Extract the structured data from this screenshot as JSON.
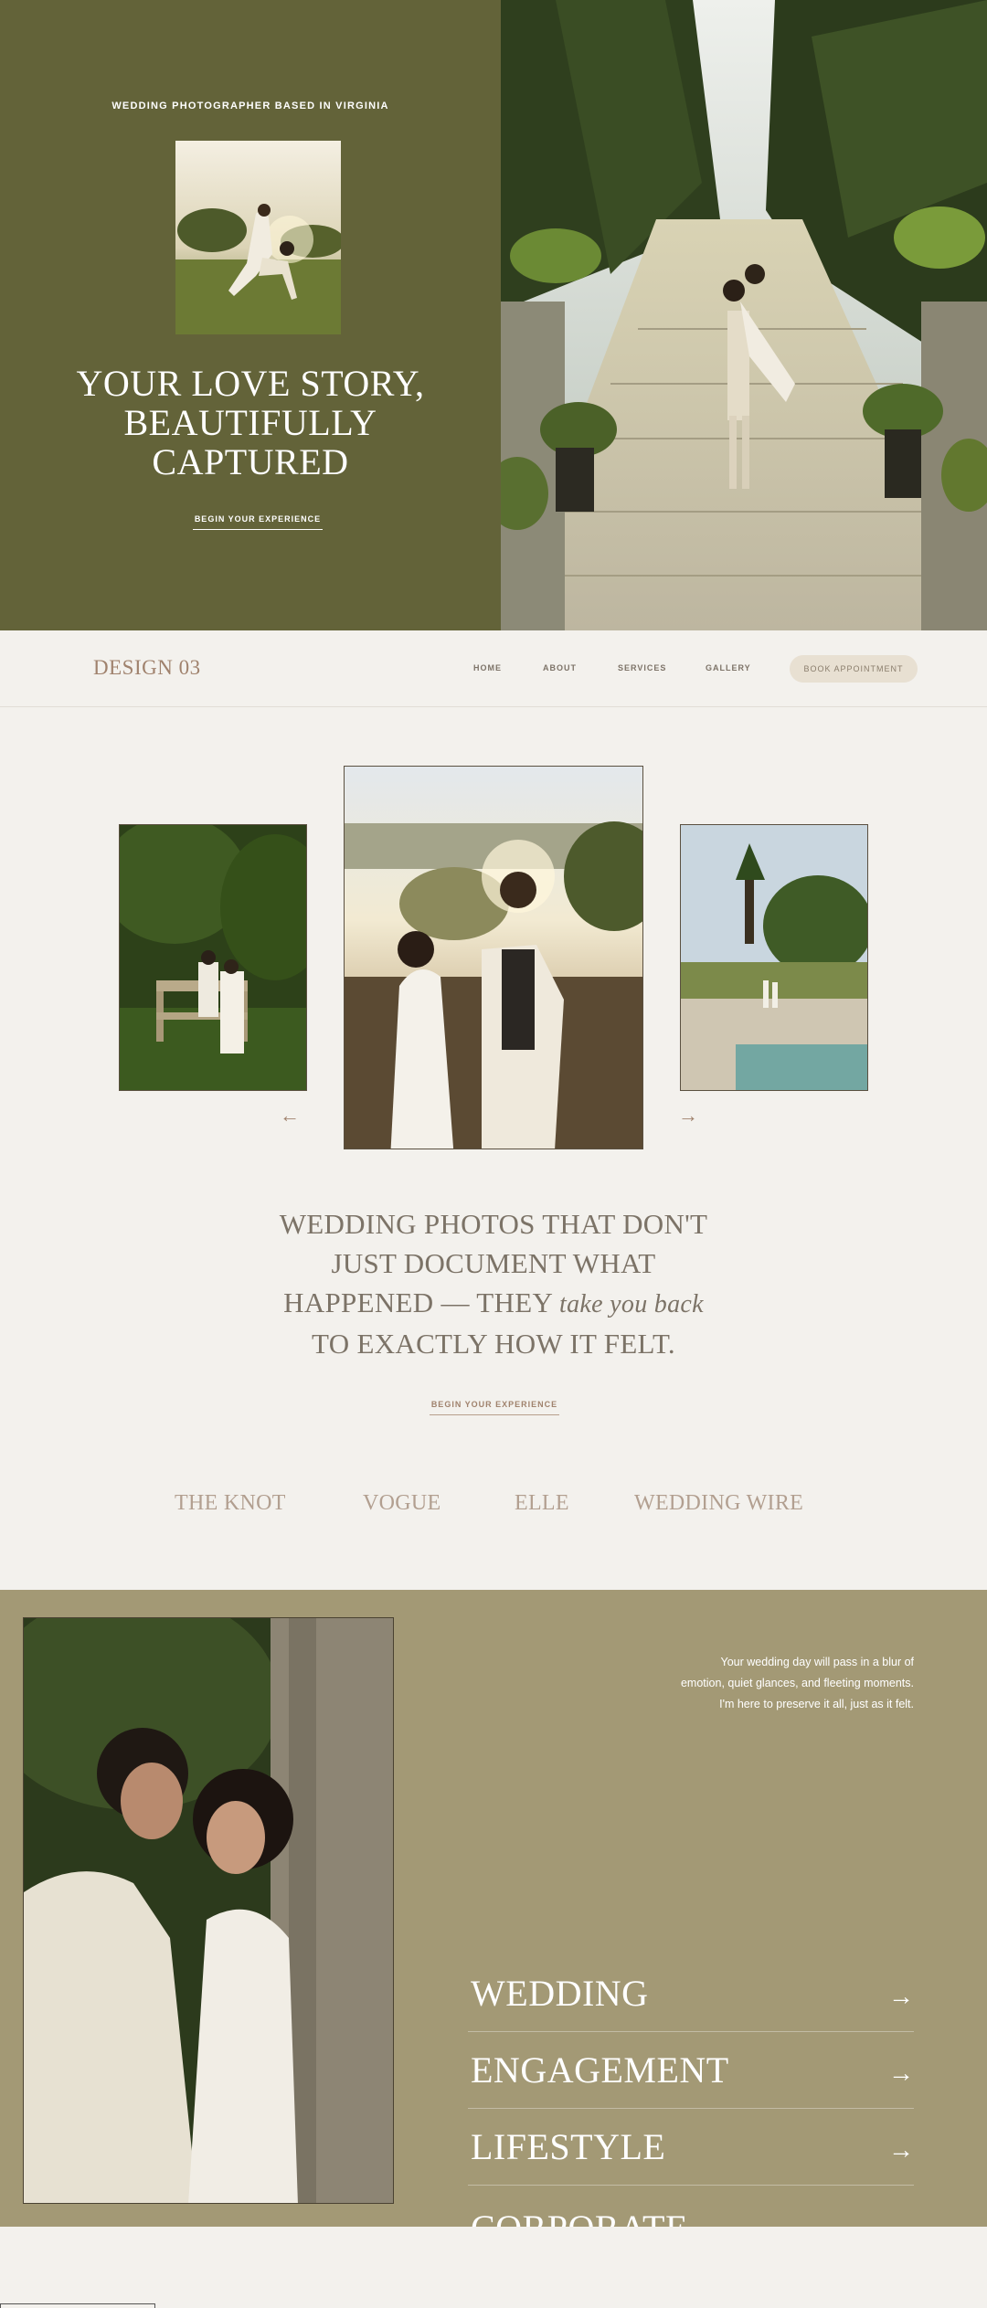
{
  "hero": {
    "eyebrow": "WEDDING PHOTOGRAPHER BASED IN VIRGINIA",
    "title_lines": [
      "YOUR LOVE STORY,",
      "BEAUTIFULLY",
      "CAPTURED"
    ],
    "cta": "BEGIN YOUR EXPERIENCE"
  },
  "nav": {
    "logo": "DESIGN 03",
    "links": [
      "HOME",
      "ABOUT",
      "SERVICES",
      "GALLERY"
    ],
    "book": "BOOK APPOINTMENT"
  },
  "gallery": {
    "prev_icon": "arrow-left-icon",
    "next_icon": "arrow-right-icon",
    "prev_glyph": "←",
    "next_glyph": "→"
  },
  "quote": {
    "lines": [
      "WEDDING PHOTOS THAT DON'T",
      "JUST DOCUMENT WHAT"
    ],
    "line3_prefix": "HAPPENED — THEY ",
    "line3_italic": "take you back",
    "line4": "TO EXACTLY HOW IT FELT.",
    "cta": "BEGIN YOUR EXPERIENCE"
  },
  "press": [
    "THE KNOT",
    "VOGUE",
    "ELLE",
    "WEDDING WIRE"
  ],
  "services": {
    "blurb_lines": [
      "Your wedding day will pass in a blur of",
      "emotion, quiet glances, and fleeting moments.",
      "I'm here to preserve it all, just as it felt."
    ],
    "items": [
      {
        "label": "WEDDING",
        "arrow": "→"
      },
      {
        "label": "ENGAGEMENT",
        "arrow": "→"
      },
      {
        "label": "LIFESTYLE",
        "arrow": "→"
      },
      {
        "label": "CORPORATE",
        "arrow": "→"
      }
    ]
  },
  "colors": {
    "olive": "#636339",
    "khaki": "#a39975",
    "cream": "#f3f1ed",
    "accent": "#a0826d"
  }
}
